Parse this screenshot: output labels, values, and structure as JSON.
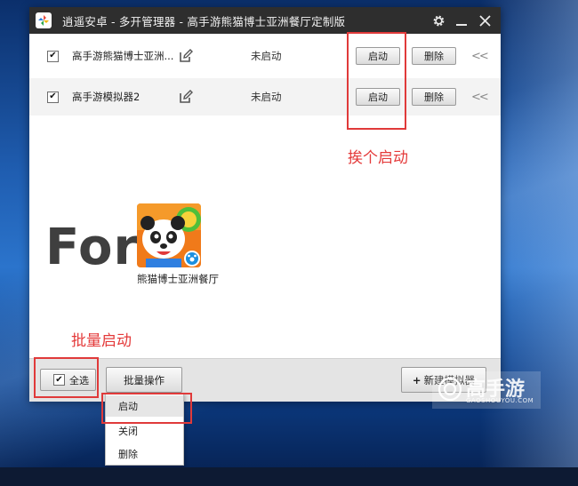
{
  "window": {
    "title": "逍遥安卓 - 多开管理器 - 高手游熊猫博士亚洲餐厅定制版"
  },
  "instances": [
    {
      "name": "高手游熊猫博士亚洲...",
      "status": "未启动",
      "start_label": "启动",
      "delete_label": "删除",
      "checked": true
    },
    {
      "name": "高手游模拟器2",
      "status": "未启动",
      "start_label": "启动",
      "delete_label": "删除",
      "checked": true
    }
  ],
  "annotations": {
    "one_by_one": "挨个启动",
    "batch": "批量启动"
  },
  "promo": {
    "for_text": "For",
    "game_name": "熊猫博士亚洲餐厅"
  },
  "bottom": {
    "select_all_label": "全选",
    "select_all_checked": true,
    "batch_ops_label": "批量操作",
    "new_emulator_label": "新建模拟器"
  },
  "batch_menu": {
    "items": [
      "启动",
      "关闭",
      "删除"
    ],
    "highlighted": "启动"
  },
  "watermark": {
    "main": "高手游",
    "sub": "GAOSHOUYOU.COM"
  },
  "colors": {
    "annotation_red": "#e43a3a",
    "titlebar": "#2e2e2e"
  }
}
